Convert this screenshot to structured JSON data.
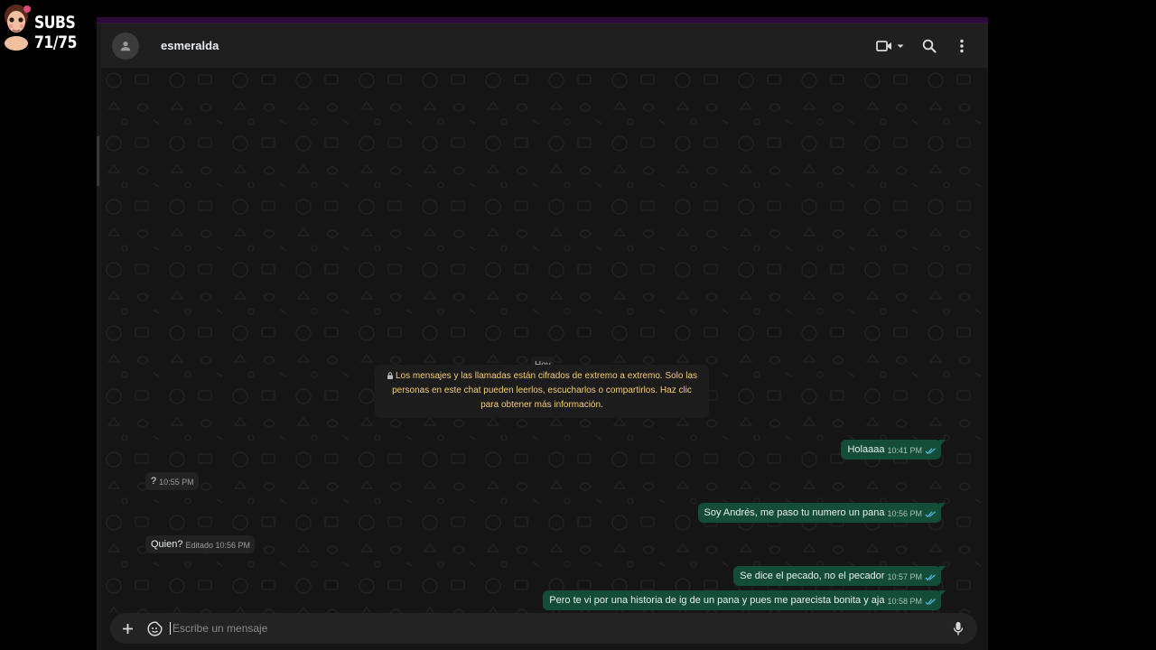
{
  "overlay": {
    "subs_text": "SUBS 71/75"
  },
  "header": {
    "contact_name": "esmeralda",
    "icons": [
      "person-icon",
      "video-call-icon",
      "chevron-down-icon",
      "search-icon",
      "more-vert-icon"
    ]
  },
  "chat": {
    "date_chip": "Hoy",
    "e2e_notice": "Los mensajes y las llamadas están cifrados de extremo a extremo. Solo las personas en este chat pueden leerlos, escucharlos o compartirlos. Haz clic para obtener más información.",
    "messages": [
      {
        "direction": "out",
        "text": "Holaaaa",
        "time": "10:41 PM",
        "status": "read"
      },
      {
        "direction": "in",
        "text": "?",
        "time": "10:55 PM",
        "edited": ""
      },
      {
        "direction": "out",
        "text": "Soy Andrés, me paso tu numero un pana",
        "time": "10:56 PM",
        "status": "read"
      },
      {
        "direction": "in",
        "text": "Quien?",
        "time": "10:56 PM",
        "edited": "Editado"
      },
      {
        "direction": "out",
        "text": "Se dice el pecado, no el pecador",
        "time": "10:57 PM",
        "status": "read"
      },
      {
        "direction": "out",
        "text": "Pero te vi por una historia de ig de un pana y pues me parecista bonita y aja",
        "time": "10:58 PM",
        "status": "read"
      }
    ]
  },
  "composer": {
    "placeholder": "Escribe un mensaje",
    "icons": [
      "plus-icon",
      "sticker-icon",
      "mic-icon"
    ]
  },
  "colors": {
    "outgoing_bubble": "#144d37",
    "incoming_bubble": "#222222",
    "notice_text": "#f7cd6f",
    "read_ticks": "#53bdeb"
  }
}
